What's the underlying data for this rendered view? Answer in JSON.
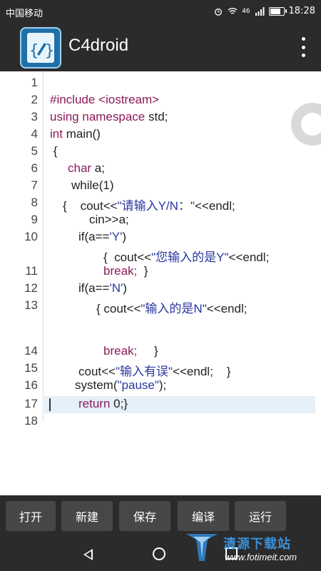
{
  "status_bar": {
    "carrier": "中国移动",
    "time": "18:28",
    "signal": "46",
    "battery_level": 0.7
  },
  "app_bar": {
    "title": "C4droid"
  },
  "editor": {
    "lines": [
      {
        "num": "1",
        "parts": []
      },
      {
        "num": "2",
        "parts": [
          {
            "t": "#include <iostream>",
            "c": "kw"
          }
        ]
      },
      {
        "num": "3",
        "parts": [
          {
            "t": "using namespace",
            "c": "kw"
          },
          {
            "t": " std;",
            "c": ""
          }
        ]
      },
      {
        "num": "4",
        "parts": [
          {
            "t": "int",
            "c": "kw"
          },
          {
            "t": " main()",
            "c": ""
          }
        ]
      },
      {
        "num": "5",
        "parts": [
          {
            "t": " {",
            "c": ""
          }
        ]
      },
      {
        "num": "6",
        "parts": [
          {
            "t": "char",
            "c": "kw"
          },
          {
            "t": " a;",
            "c": ""
          }
        ]
      },
      {
        "num": "7",
        "parts": [
          {
            "t": "while(1)",
            "c": ""
          }
        ]
      },
      {
        "num": "8",
        "parts": [
          {
            "t": "{    cout<<",
            "c": ""
          },
          {
            "t": "\"请输入Y/N：\"",
            "c": "str"
          },
          {
            "t": "<<endl;",
            "c": ""
          }
        ]
      },
      {
        "num": "9",
        "parts": [
          {
            "t": "cin>>a;",
            "c": ""
          }
        ]
      },
      {
        "num": "10",
        "parts": [
          {
            "t": "if(a==",
            "c": ""
          },
          {
            "t": "'Y'",
            "c": "str"
          },
          {
            "t": ")",
            "c": ""
          }
        ]
      },
      {
        "num": "",
        "parts": [
          {
            "t": "{  cout<<",
            "c": ""
          },
          {
            "t": "\"您输入的是Y\"",
            "c": "str"
          },
          {
            "t": "<<endl;",
            "c": ""
          }
        ]
      },
      {
        "num": "11",
        "parts": [
          {
            "t": "break;",
            "c": "kw"
          },
          {
            "t": "  }",
            "c": ""
          }
        ]
      },
      {
        "num": "12",
        "parts": [
          {
            "t": "if(a==",
            "c": ""
          },
          {
            "t": "'N'",
            "c": "str"
          },
          {
            "t": ")",
            "c": ""
          }
        ]
      },
      {
        "num": "13",
        "parts": [
          {
            "t": "{ cout<<",
            "c": ""
          },
          {
            "t": "\"输入的是N\"",
            "c": "str"
          },
          {
            "t": "<<endl;",
            "c": ""
          }
        ]
      },
      {
        "num": "",
        "parts": []
      },
      {
        "num": "14",
        "parts": [
          {
            "t": "break;",
            "c": "kw"
          },
          {
            "t": "     }",
            "c": ""
          }
        ]
      },
      {
        "num": "15",
        "parts": [
          {
            "t": "cout<<",
            "c": ""
          },
          {
            "t": "\"输入有误\"",
            "c": "str"
          },
          {
            "t": "<<endl;    }",
            "c": ""
          }
        ]
      },
      {
        "num": "16",
        "parts": [
          {
            "t": "system(",
            "c": ""
          },
          {
            "t": "\"pause\"",
            "c": "str"
          },
          {
            "t": ");",
            "c": ""
          }
        ]
      },
      {
        "num": "17",
        "parts": [
          {
            "t": "return",
            "c": "kw"
          },
          {
            "t": " 0;}",
            "c": ""
          }
        ]
      },
      {
        "num": "18",
        "parts": []
      }
    ]
  },
  "toolbar": {
    "open_label": "打开",
    "new_label": "新建",
    "save_label": "保存",
    "compile_label": "编译",
    "run_label": "运行"
  },
  "watermark": {
    "text": "清源下载站",
    "url": "www.fotimeit.com"
  }
}
